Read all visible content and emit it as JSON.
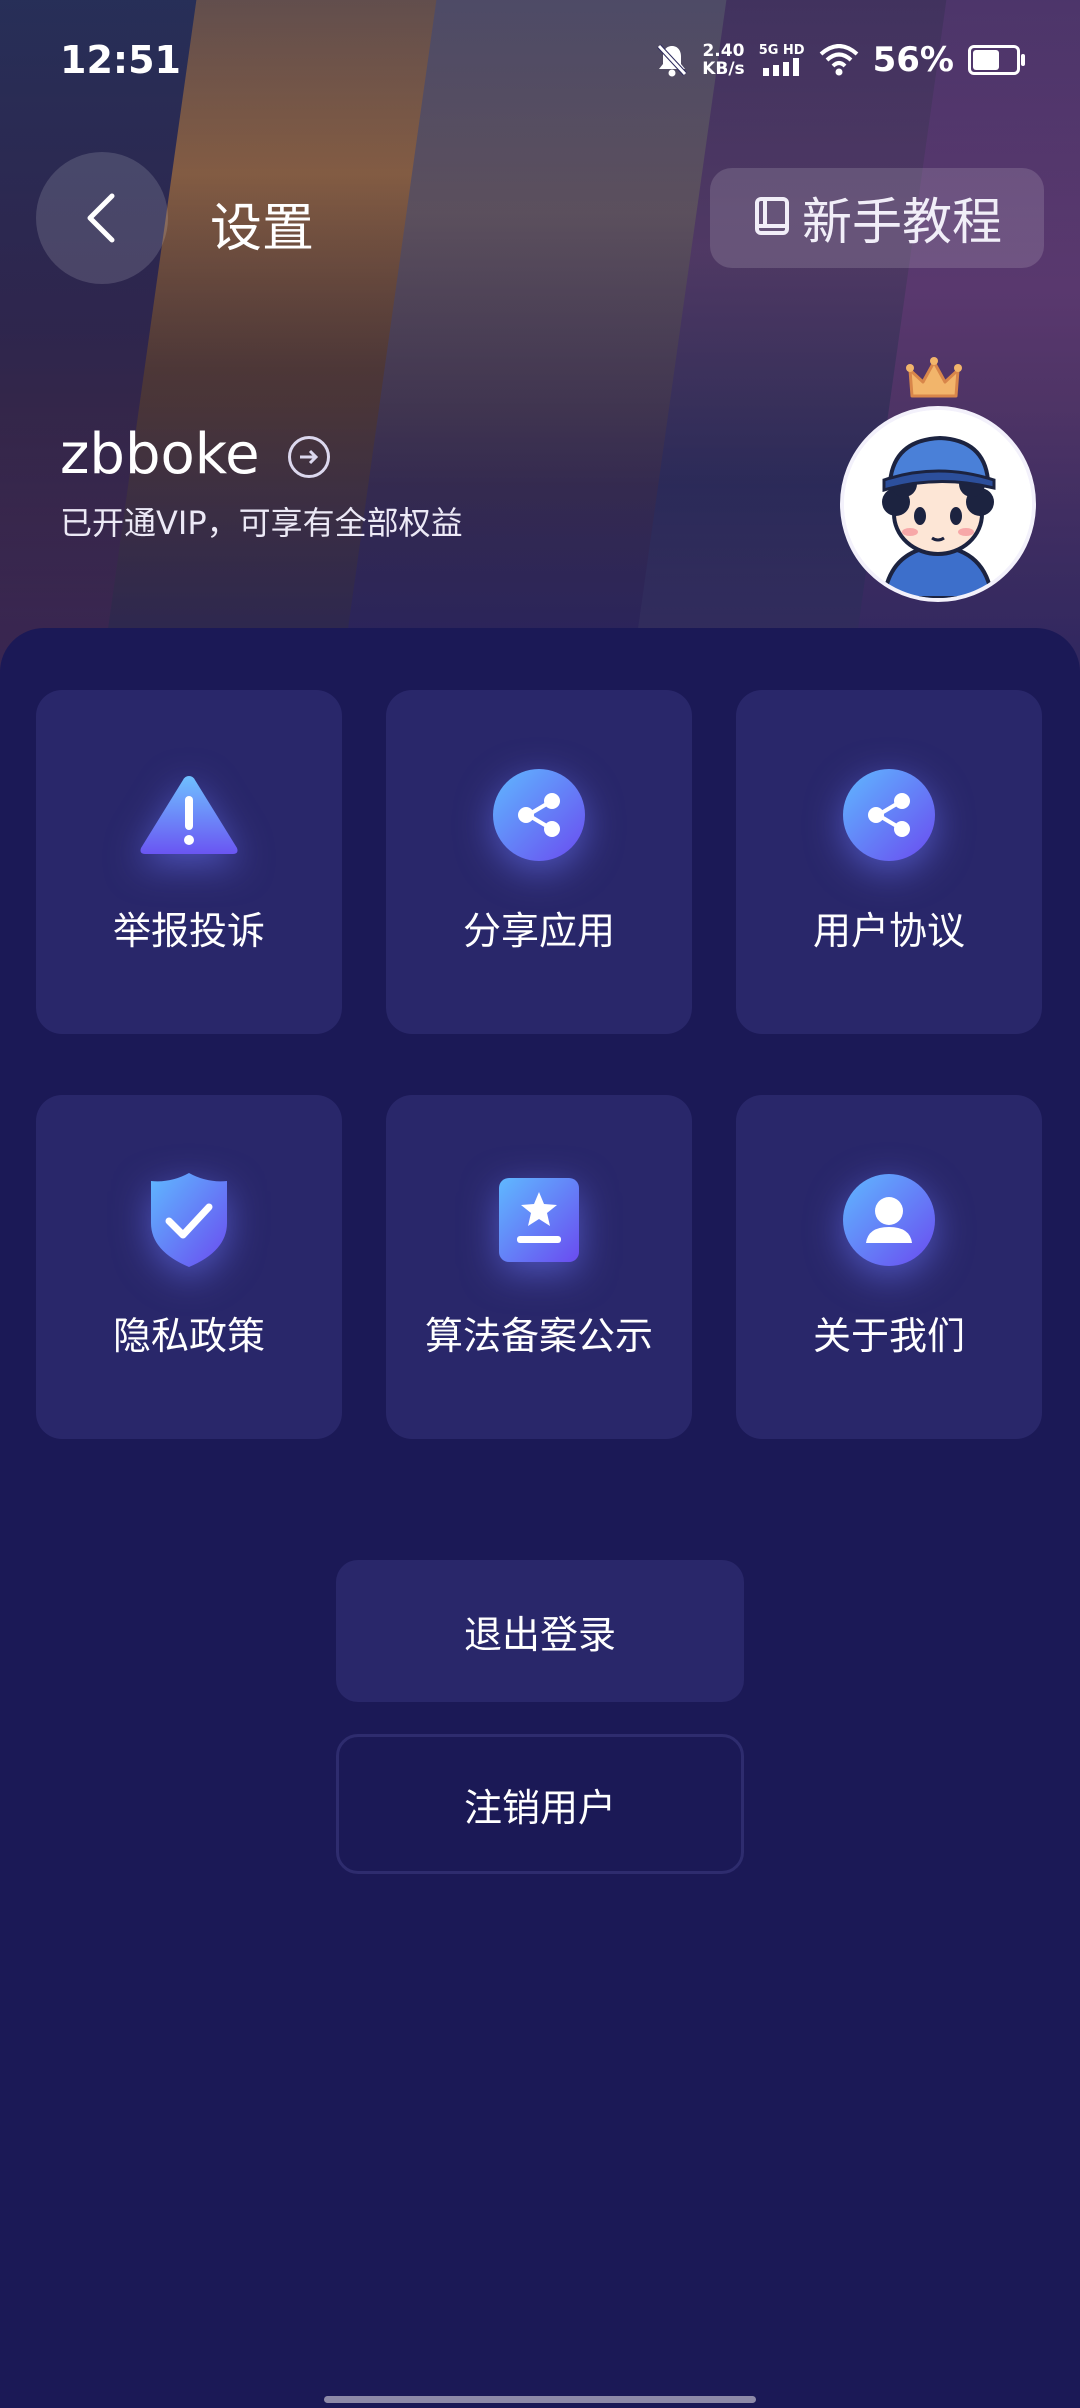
{
  "status_bar": {
    "time": "12:51",
    "speed_value": "2.40",
    "speed_unit": "KB/s",
    "net_type": "5G HD",
    "battery_percent": "56%",
    "battery_level": 0.56
  },
  "header": {
    "title": "设置",
    "tutorial_label": "新手教程"
  },
  "profile": {
    "username": "zbboke",
    "vip_text": "已开通VIP，可享有全部权益"
  },
  "menu": {
    "items": [
      {
        "label": "举报投诉",
        "icon": "warning-icon"
      },
      {
        "label": "分享应用",
        "icon": "share-icon"
      },
      {
        "label": "用户协议",
        "icon": "share-icon"
      },
      {
        "label": "隐私政策",
        "icon": "shield-check-icon"
      },
      {
        "label": "算法备案公示",
        "icon": "star-document-icon"
      },
      {
        "label": "关于我们",
        "icon": "user-icon"
      }
    ]
  },
  "actions": {
    "logout_label": "退出登录",
    "cancel_account_label": "注销用户"
  },
  "colors": {
    "background": "#1b1956",
    "card": "#29276a",
    "accent_gradient_start": "#5fb1ff",
    "accent_gradient_end": "#6c4cf0"
  }
}
